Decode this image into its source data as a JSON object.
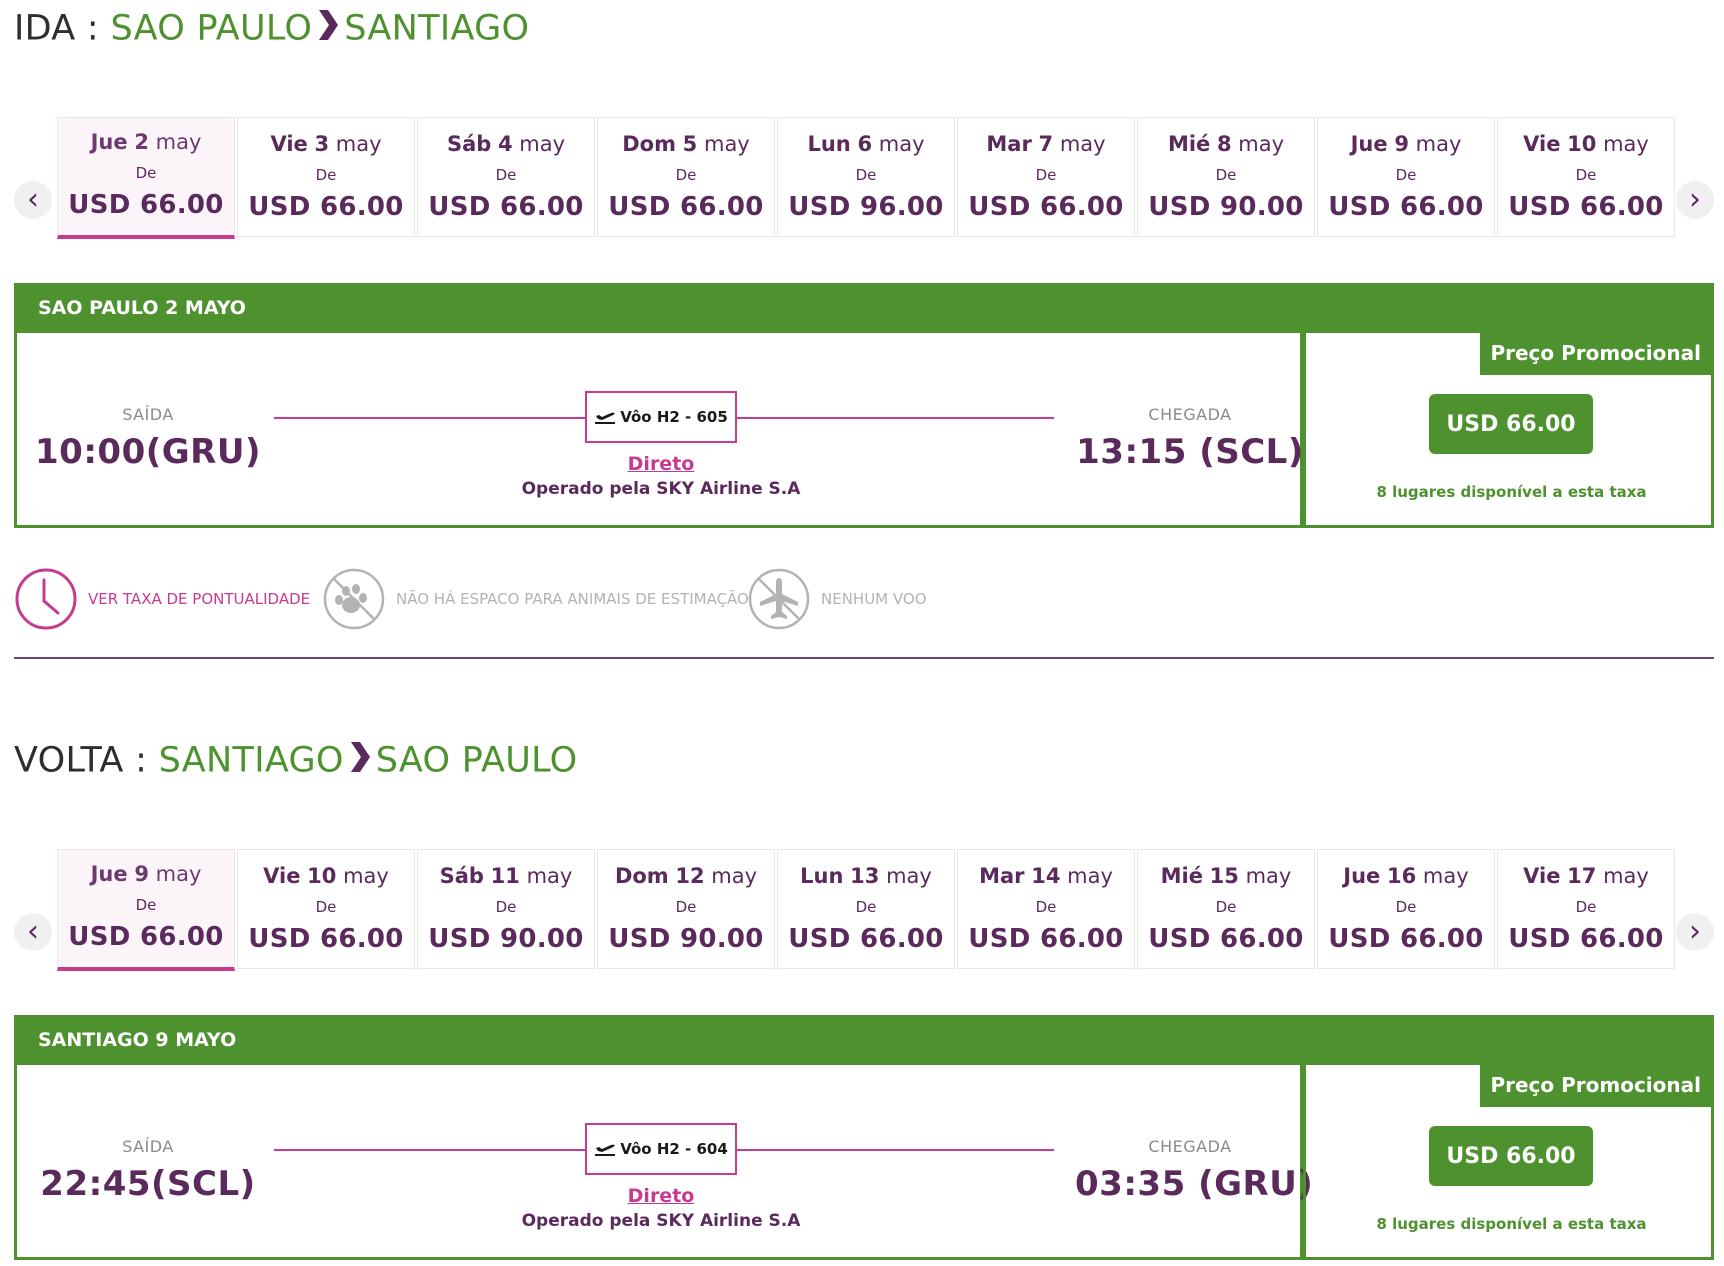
{
  "colors": {
    "green": "#4e9230",
    "purple": "#5b2a5c",
    "magenta": "#c63b8f",
    "muted": "#b3b3b3"
  },
  "ida": {
    "prefix": "IDA :",
    "origin": "SAO PAULO",
    "destination": "SANTIAGO",
    "dates": [
      {
        "dname": "Jue",
        "dnum": "2",
        "month": "may",
        "from": "De",
        "price": "USD 66.00",
        "selected": true
      },
      {
        "dname": "Vie",
        "dnum": "3",
        "month": "may",
        "from": "De",
        "price": "USD 66.00"
      },
      {
        "dname": "Sáb",
        "dnum": "4",
        "month": "may",
        "from": "De",
        "price": "USD 66.00"
      },
      {
        "dname": "Dom",
        "dnum": "5",
        "month": "may",
        "from": "De",
        "price": "USD 66.00"
      },
      {
        "dname": "Lun",
        "dnum": "6",
        "month": "may",
        "from": "De",
        "price": "USD 96.00"
      },
      {
        "dname": "Mar",
        "dnum": "7",
        "month": "may",
        "from": "De",
        "price": "USD 66.00"
      },
      {
        "dname": "Mié",
        "dnum": "8",
        "month": "may",
        "from": "De",
        "price": "USD 90.00"
      },
      {
        "dname": "Jue",
        "dnum": "9",
        "month": "may",
        "from": "De",
        "price": "USD 66.00"
      },
      {
        "dname": "Vie",
        "dnum": "10",
        "month": "may",
        "from": "De",
        "price": "USD 66.00"
      }
    ],
    "flight": {
      "header": "SAO PAULO 2 MAYO",
      "dep_label": "SAÍDA",
      "dep_time": "10:00(GRU)",
      "arr_label": "CHEGADA",
      "arr_time": "13:15 (SCL)",
      "flight_no": "Vôo H2 - 605",
      "direct": "Direto",
      "operator": "Operado pela SKY Airline S.A",
      "promo": "Preço Promocional",
      "fare": "USD 66.00",
      "seats": "8 lugares disponível a esta taxa"
    },
    "features": {
      "punctuality": "VER TAXA DE PONTUALIDADE",
      "pets": "NÃO HÁ ESPACO PARA ANIMAIS DE ESTIMAÇÃO",
      "no_flight": "NENHUM VOO"
    }
  },
  "volta": {
    "prefix": "VOLTA :",
    "origin": "SANTIAGO",
    "destination": "SAO PAULO",
    "dates": [
      {
        "dname": "Jue",
        "dnum": "9",
        "month": "may",
        "from": "De",
        "price": "USD 66.00",
        "selected": true
      },
      {
        "dname": "Vie",
        "dnum": "10",
        "month": "may",
        "from": "De",
        "price": "USD 66.00"
      },
      {
        "dname": "Sáb",
        "dnum": "11",
        "month": "may",
        "from": "De",
        "price": "USD 90.00"
      },
      {
        "dname": "Dom",
        "dnum": "12",
        "month": "may",
        "from": "De",
        "price": "USD 90.00"
      },
      {
        "dname": "Lun",
        "dnum": "13",
        "month": "may",
        "from": "De",
        "price": "USD 66.00"
      },
      {
        "dname": "Mar",
        "dnum": "14",
        "month": "may",
        "from": "De",
        "price": "USD 66.00"
      },
      {
        "dname": "Mié",
        "dnum": "15",
        "month": "may",
        "from": "De",
        "price": "USD 66.00"
      },
      {
        "dname": "Jue",
        "dnum": "16",
        "month": "may",
        "from": "De",
        "price": "USD 66.00"
      },
      {
        "dname": "Vie",
        "dnum": "17",
        "month": "may",
        "from": "De",
        "price": "USD 66.00"
      }
    ],
    "flight": {
      "header": "SANTIAGO 9 MAYO",
      "dep_label": "SAÍDA",
      "dep_time": "22:45(SCL)",
      "arr_label": "CHEGADA",
      "arr_time": "03:35 (GRU)",
      "flight_no": "Vôo H2 - 604",
      "direct": "Direto",
      "operator": "Operado pela SKY Airline S.A",
      "promo": "Preço Promocional",
      "fare": "USD 66.00",
      "seats": "8 lugares disponível a esta taxa"
    }
  }
}
